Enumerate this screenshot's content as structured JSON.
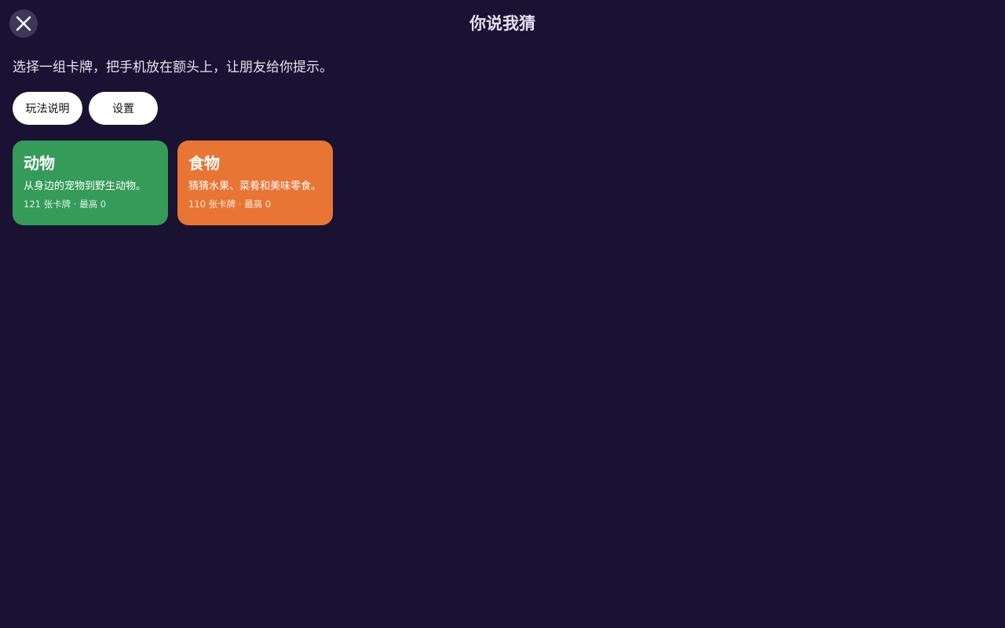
{
  "header": {
    "title": "你说我猜",
    "close_icon": "close-icon"
  },
  "intro": {
    "subtitle": "选择一组卡牌，把手机放在额头上，让朋友给你提示。"
  },
  "actions": {
    "how_to_play_label": "玩法说明",
    "settings_label": "设置"
  },
  "decks": [
    {
      "name": "动物",
      "description": "从身边的宠物到野生动物。",
      "meta": "121 张卡牌 · 最高 0",
      "color": "#349b59"
    },
    {
      "name": "食物",
      "description": "猜猜水果、菜肴和美味零食。",
      "meta": "110 张卡牌 · 最高 0",
      "color": "#e87534"
    }
  ],
  "colors": {
    "background": "#1a1233",
    "close_button": "#3e3858"
  }
}
